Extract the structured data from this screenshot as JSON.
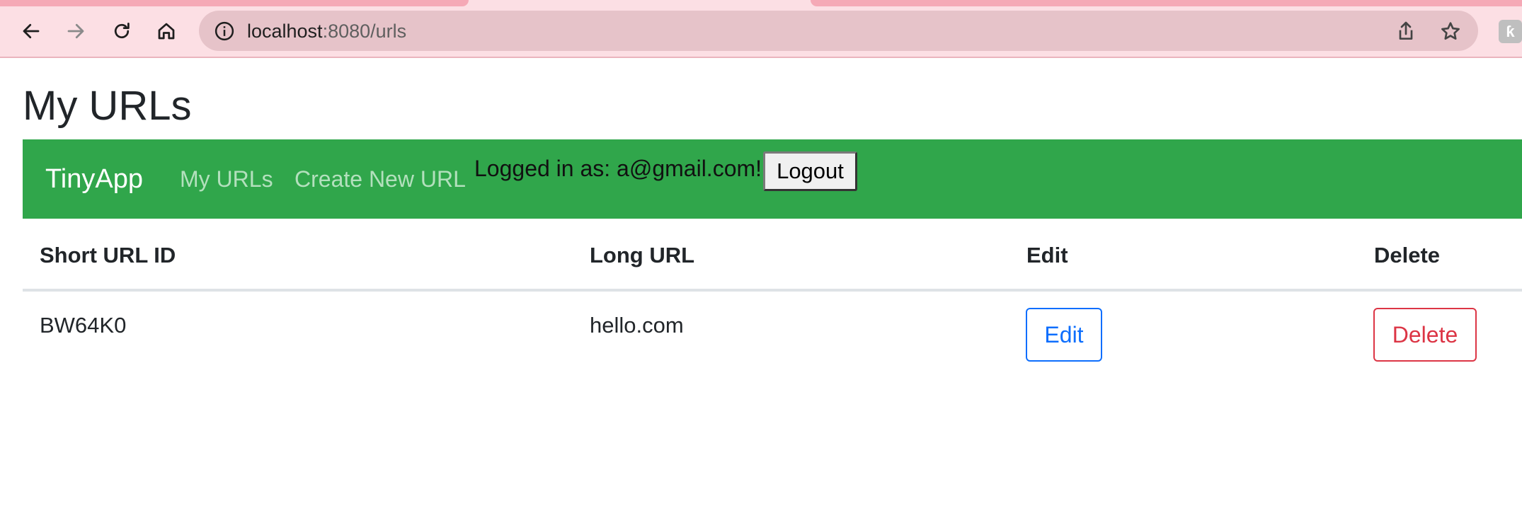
{
  "browser": {
    "url_host": "localhost",
    "url_rest": ":8080/urls",
    "icons": [
      "back-arrow-icon",
      "forward-arrow-icon",
      "reload-icon",
      "home-icon",
      "info-icon",
      "share-icon",
      "star-icon",
      "extension-icon"
    ],
    "extension_label": "ƙ"
  },
  "page": {
    "title": "My URLs"
  },
  "navbar": {
    "brand": "TinyApp",
    "links": [
      "My URLs",
      "Create New URL"
    ],
    "logged_in_text": "Logged in as: a@gmail.com!",
    "logout_label": "Logout",
    "color": "#30a64b"
  },
  "table": {
    "headers": [
      "Short URL ID",
      "Long URL",
      "Edit",
      "Delete"
    ],
    "rows": [
      {
        "short_id": "BW64K0",
        "long_url": "hello.com",
        "edit_label": "Edit",
        "delete_label": "Delete"
      }
    ]
  }
}
